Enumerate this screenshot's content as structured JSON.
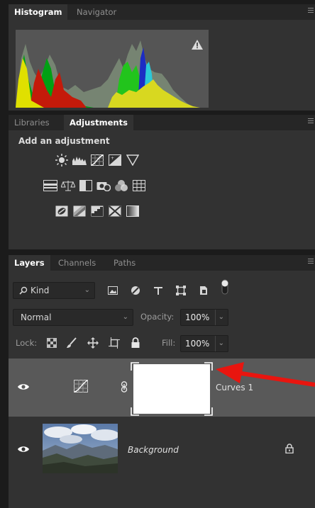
{
  "histogram_panel": {
    "tabs": [
      "Histogram",
      "Navigator"
    ],
    "warning_icon": "warning-triangle-icon"
  },
  "adjustments_panel": {
    "tabs": [
      "Libraries",
      "Adjustments"
    ],
    "heading": "Add an adjustment",
    "icon_rows": [
      [
        "brightness-contrast-icon",
        "levels-icon",
        "curves-icon",
        "exposure-icon",
        "vibrance-icon"
      ],
      [
        "hue-saturation-icon",
        "color-balance-icon",
        "black-white-icon",
        "photo-filter-icon",
        "channel-mixer-icon",
        "color-lookup-icon"
      ],
      [
        "invert-icon",
        "posterize-icon",
        "threshold-icon",
        "selective-color-icon",
        "gradient-map-icon"
      ]
    ]
  },
  "layers_panel": {
    "tabs": [
      "Layers",
      "Channels",
      "Paths"
    ],
    "filter": {
      "label": "Kind"
    },
    "blend_mode": "Normal",
    "opacity_label": "Opacity:",
    "opacity_value": "100%",
    "lock_label": "Lock:",
    "fill_label": "Fill:",
    "fill_value": "100%",
    "layers": [
      {
        "name": "Curves 1",
        "selected": true
      },
      {
        "name": "Background",
        "locked": true
      }
    ]
  },
  "colors": {
    "panel_bg": "#323232",
    "selected_row": "#595959",
    "arrow": "#e8150f"
  }
}
